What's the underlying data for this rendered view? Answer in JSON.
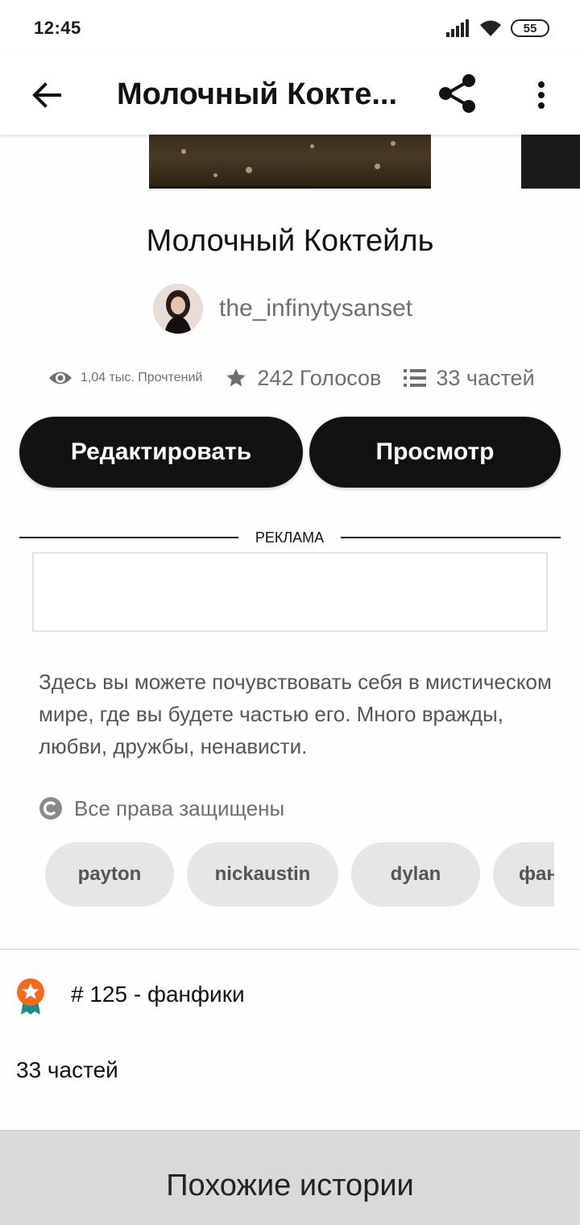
{
  "status_bar": {
    "time": "12:45",
    "battery": "55"
  },
  "app_bar": {
    "title": "Молочный Кокте...",
    "back_icon": "arrow-left-icon",
    "share_icon": "share-icon",
    "more_icon": "more-vertical-icon"
  },
  "story": {
    "title": "Молочный Коктейль",
    "author": "the_infinytysanset",
    "stats": {
      "reads": "1,04 тыс. Прочтений",
      "votes": "242 Голосов",
      "parts": "33 частей"
    }
  },
  "actions": {
    "edit_label": "Редактировать",
    "view_label": "Просмотр"
  },
  "ad": {
    "label": "РЕКЛАМА"
  },
  "description": "Здесь вы можете почувствовать себя в мистическом мире, где вы будете частью его. Много вражды, любви, дружбы, ненависти.",
  "copyright": {
    "label": "Все права защищены",
    "icon": "copyright-icon"
  },
  "tags": [
    "payton",
    "nickaustin",
    "dylan",
    "фанфики"
  ],
  "ranking": {
    "text": "# 125 - фанфики",
    "icon": "award-badge-icon",
    "badge_color": "#f26a1b",
    "ribbon_color": "#1a8c8c"
  },
  "parts_count": "33 частей",
  "similar": {
    "title": "Похожие истории"
  }
}
